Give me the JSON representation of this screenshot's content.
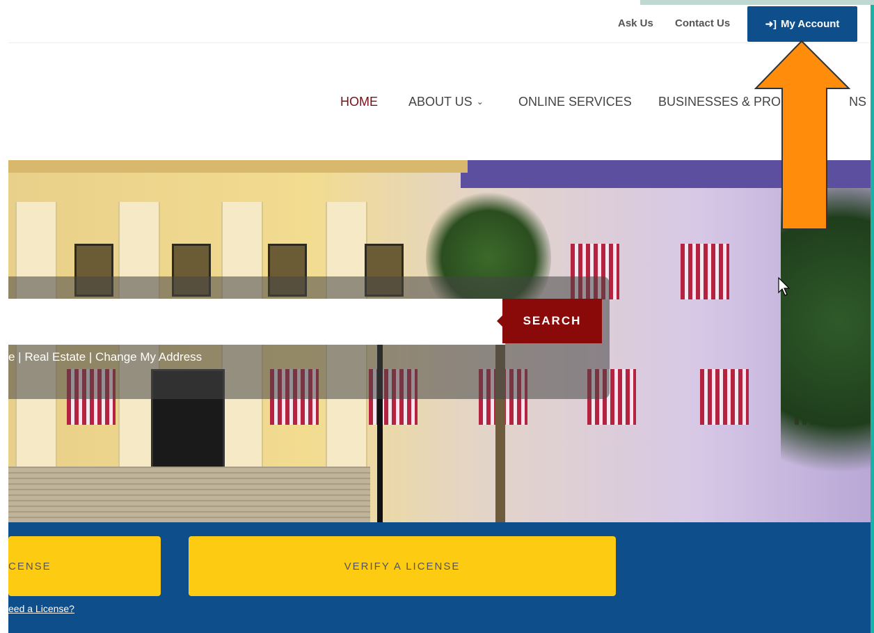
{
  "utility_nav": {
    "ask_us": "Ask Us",
    "contact_us": "Contact Us",
    "my_account": "My Account"
  },
  "main_nav": {
    "items": [
      {
        "label": "HOME"
      },
      {
        "label": "ABOUT US"
      },
      {
        "label": "ONLINE SERVICES"
      },
      {
        "label": "BUSINESSES & PRO"
      },
      {
        "label": "NS"
      }
    ]
  },
  "search": {
    "button_label": "SEARCH",
    "input_value": "",
    "quick_links": "e | Real Estate | Change My Address"
  },
  "actions": {
    "apply_label": "CENSE",
    "verify_label": "VERIFY A LICENSE",
    "need_link": "eed a License?"
  },
  "colors": {
    "accent_blue": "#0e4e8a",
    "nav_active": "#7c1018",
    "search_button": "#8a0a0a",
    "button_yellow": "#fecb13",
    "annotation_arrow": "#ff8c0a"
  }
}
